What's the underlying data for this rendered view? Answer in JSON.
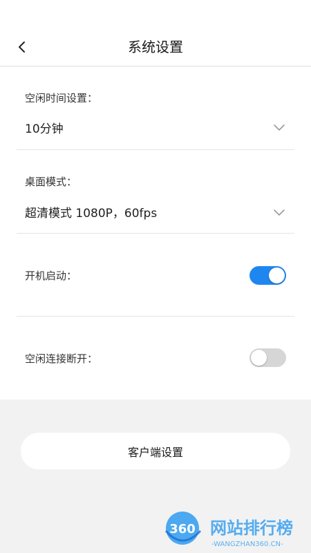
{
  "header": {
    "title": "系统设置",
    "back_icon": "chevron-left-icon"
  },
  "settings": {
    "idle_time": {
      "label": "空闲时间设置：",
      "value": "10分钟",
      "icon": "chevron-down-icon"
    },
    "desktop_mode": {
      "label": "桌面模式：",
      "value": "超清模式 1080P，60fps",
      "icon": "chevron-down-icon"
    },
    "auto_start": {
      "label": "开机启动：",
      "enabled": true
    },
    "idle_disconnect": {
      "label": "空闲连接断开：",
      "enabled": false
    }
  },
  "client_button": {
    "label": "客户端设置"
  },
  "watermark": {
    "logo_text": "360",
    "brand": "网站排行榜",
    "url": "-WANGZHAN360.CN-"
  },
  "colors": {
    "accent": "#1f86f0",
    "toggle_off": "#d6d6d6",
    "background": "#f2f2f2"
  }
}
